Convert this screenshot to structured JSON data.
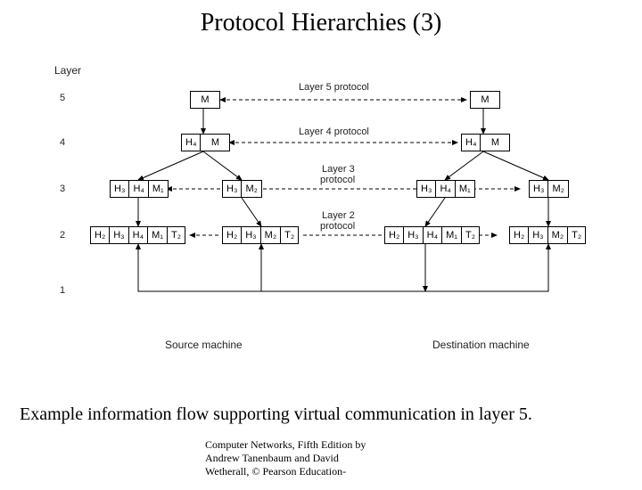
{
  "title": "Protocol Hierarchies (3)",
  "caption": "Example information flow supporting virtual communication in layer 5.",
  "footer_line1": "Computer Networks, Fifth Edition by",
  "footer_line2": "Andrew Tanenbaum and David",
  "footer_line3": "Wetherall, © Pearson Education-",
  "labels": {
    "layer": "Layer",
    "l5": "5",
    "l4": "4",
    "l3": "3",
    "l2": "2",
    "l1": "1",
    "p5": "Layer 5 protocol",
    "p4": "Layer 4 protocol",
    "p3a": "Layer 3",
    "p3b": "protocol",
    "p2a": "Layer 2",
    "p2b": "protocol",
    "src": "Source machine",
    "dst": "Destination machine"
  },
  "segs": {
    "M": "M",
    "H2": "H₂",
    "H3": "H₃",
    "H4": "H₄",
    "M1": "M₁",
    "M2": "M₂",
    "T2": "T₂"
  }
}
